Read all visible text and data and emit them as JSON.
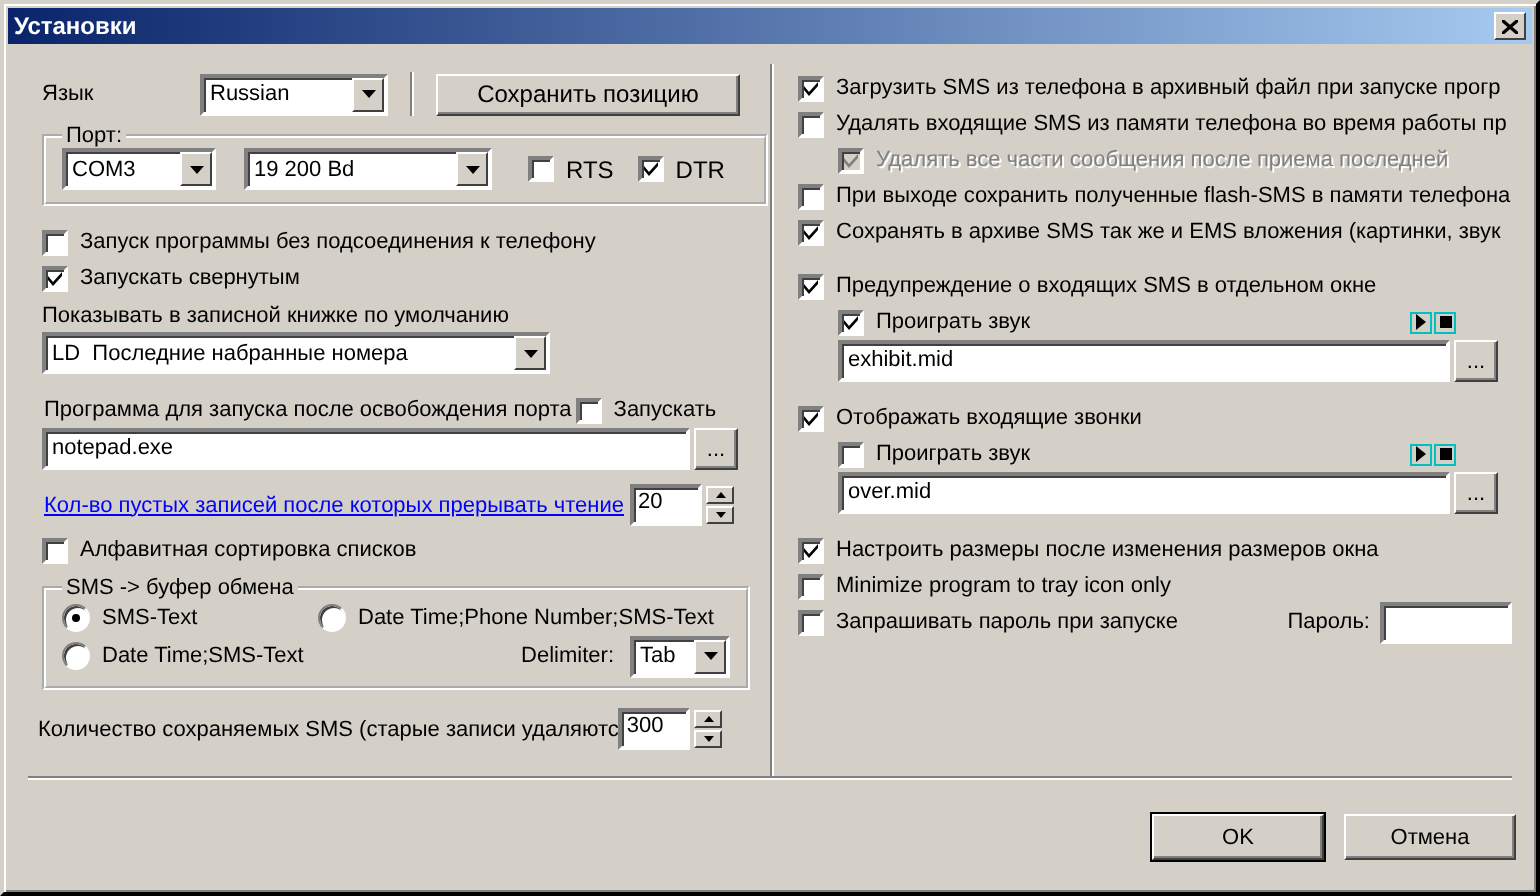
{
  "window": {
    "title": "Установки"
  },
  "language": {
    "label": "Язык",
    "value": "Russian"
  },
  "save_position_button": "Сохранить позицию",
  "port": {
    "legend": "Порт:",
    "port": "COM3",
    "speed": "19 200 Bd",
    "checks": [
      {
        "label": "RTS",
        "checked": false
      },
      {
        "label": "DTR",
        "checked": true
      }
    ]
  },
  "left_options": [
    {
      "label": "Запуск программы без подсоединения к телефону",
      "checked": false
    },
    {
      "label": "Запускать свернутым",
      "checked": true
    }
  ],
  "phonebook": {
    "label": "Показывать в записной книжке по умолчанию",
    "value": "LD  Последние набранные номера"
  },
  "program": {
    "label": "Программа для запуска после освобождения порта",
    "run": {
      "label": "Запускать",
      "checked": false
    },
    "value": "notepad.exe",
    "browse": "..."
  },
  "empty_records": {
    "label": "Кол-во пустых записей после которых прерывать чтение",
    "value": "20"
  },
  "sort": {
    "label": "Алфавитная сортировка списков",
    "checked": false
  },
  "clipboard": {
    "legend": "SMS -> буфер обмена",
    "options": [
      {
        "label": "SMS-Text",
        "selected": true
      },
      {
        "label": "Date Time;SMS-Text",
        "selected": false
      },
      {
        "label": "Date Time;Phone Number;SMS-Text",
        "selected": false
      }
    ],
    "delimiter": {
      "label": "Delimiter:",
      "value": "Tab"
    }
  },
  "sms_count": {
    "label": "Количество сохраняемых SMS (старые записи удаляютс",
    "value": "300"
  },
  "right_groups": [
    [
      {
        "kind": "check",
        "label": "Загрузить SMS из телефона в архивный файл при запуске прогр",
        "checked": true,
        "disabled": false
      },
      {
        "kind": "check",
        "label": "Удалять входящие SMS из памяти телефона во время работы пр",
        "checked": false,
        "disabled": false,
        "children": [
          {
            "kind": "check",
            "label": "Удалять все части сообщения после приема последней",
            "checked": true,
            "disabled": true
          }
        ]
      },
      {
        "kind": "check",
        "label": "При выходе сохранить полученные flash-SMS в памяти телефона",
        "checked": false,
        "disabled": false
      },
      {
        "kind": "check",
        "label": "Сохранять в архиве SMS так же и EMS вложения (картинки, звук",
        "checked": true,
        "disabled": false
      }
    ],
    [
      {
        "kind": "check",
        "label": "Предупреждение о входящих SMS в отдельном окне",
        "checked": true,
        "disabled": false,
        "children": [
          {
            "kind": "sound",
            "label": "Проиграть звук",
            "checked": true,
            "file": "exhibit.mid",
            "browse": "..."
          }
        ]
      }
    ],
    [
      {
        "kind": "check",
        "label": "Отображать входящие звонки",
        "checked": true,
        "disabled": false,
        "children": [
          {
            "kind": "sound",
            "label": "Проиграть звук",
            "checked": false,
            "file": "over.mid",
            "browse": "..."
          }
        ]
      }
    ],
    [
      {
        "kind": "check",
        "label": "Настроить размеры после изменения размеров окна",
        "checked": true,
        "disabled": false
      },
      {
        "kind": "check",
        "label": "Minimize program to tray icon only",
        "checked": false,
        "disabled": false
      },
      {
        "kind": "password",
        "label": "Запрашивать пароль при запуске",
        "checked": false,
        "disabled": false,
        "password_label": "Пароль:"
      }
    ]
  ],
  "buttons": [
    {
      "label": "OK",
      "default": true
    },
    {
      "label": "Отмена",
      "default": false
    }
  ]
}
